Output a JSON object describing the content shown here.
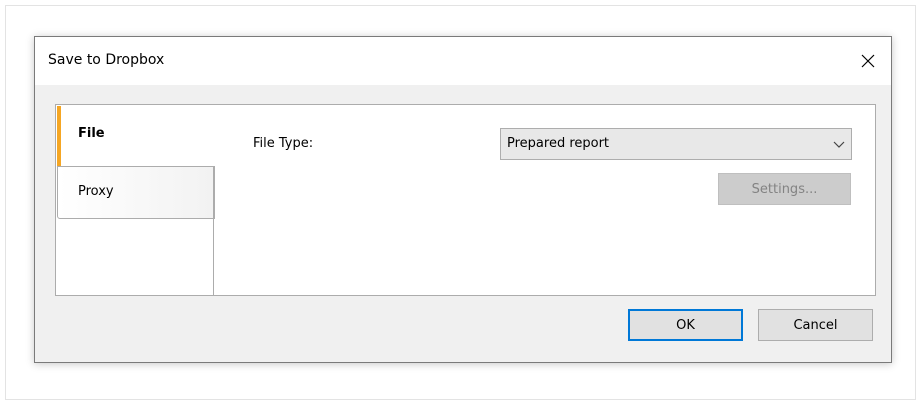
{
  "dialog": {
    "title": "Save to Dropbox"
  },
  "tabs": [
    {
      "label": "File",
      "active": true
    },
    {
      "label": "Proxy",
      "active": false
    }
  ],
  "file_tab": {
    "file_type_label": "File Type:",
    "file_type_value": "Prepared report",
    "settings_label": "Settings..."
  },
  "buttons": {
    "ok_label": "OK",
    "cancel_label": "Cancel"
  },
  "colors": {
    "accent_tab": "#f5a623",
    "default_button_border": "#0078d7"
  },
  "icons": {
    "close": "close-icon",
    "dropdown": "chevron-down-icon"
  }
}
